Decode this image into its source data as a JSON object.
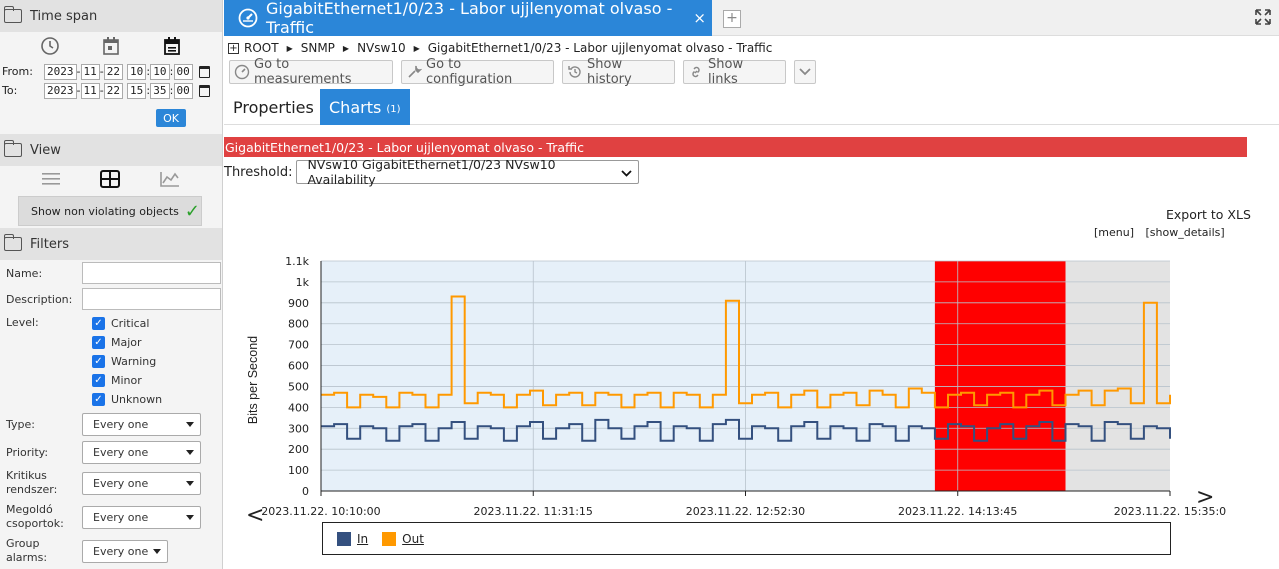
{
  "sidebar": {
    "time_span": {
      "title": "Time span",
      "from_label": "From:",
      "to_label": "To:",
      "from": {
        "year": "2023",
        "month": "11",
        "day": "22",
        "hour": "10",
        "minute": "10",
        "second": "00"
      },
      "to": {
        "year": "2023",
        "month": "11",
        "day": "22",
        "hour": "15",
        "minute": "35",
        "second": "00"
      },
      "ok_label": "OK"
    },
    "view": {
      "title": "View",
      "non_violating_label": "Show non violating objects"
    },
    "filters": {
      "title": "Filters",
      "name_label": "Name:",
      "description_label": "Description:",
      "level_label": "Level:",
      "levels": [
        "Critical",
        "Major",
        "Warning",
        "Minor",
        "Unknown"
      ],
      "type_label": "Type:",
      "priority_label": "Priority:",
      "kritikus_label_1": "Kritikus",
      "kritikus_label_2": "rendszer:",
      "megoldo_label_1": "Megoldó",
      "megoldo_label_2": "csoportok:",
      "group_label_1": "Group",
      "group_label_2": "alarms:",
      "select_value": "Every one"
    }
  },
  "tab": {
    "title": "GigabitEthernet1/0/23 - Labor ujjlenyomat olvaso - Traffic",
    "close": "×",
    "add": "+"
  },
  "breadcrumb": [
    "ROOT",
    "SNMP",
    "NVsw10",
    "GigabitEthernet1/0/23 - Labor ujjlenyomat olvaso - Traffic"
  ],
  "toolbar": {
    "measurements": "Go to measurements",
    "configuration": "Go to configuration",
    "history": "Show history",
    "links": "Show links"
  },
  "page_tabs": {
    "properties": "Properties",
    "charts": "Charts",
    "charts_count": "(1)"
  },
  "chart_banner": "GigabitEthernet1/0/23 - Labor ujjlenyomat olvaso - Traffic",
  "threshold": {
    "label": "Threshold:",
    "value": "NVsw10 GigabitEthernet1/0/23 NVsw10 Availability"
  },
  "export_label": "Export to XLS",
  "chart_links": {
    "menu": "[menu]",
    "details": "[show_details]"
  },
  "colors": {
    "accent": "#2b86d8",
    "in": "#34507f",
    "out": "#ff9900",
    "violation": "#ff0000",
    "banner": "#e04141"
  },
  "chart_data": {
    "type": "line",
    "ylabel": "Bits per Second",
    "ylim": [
      0,
      1100
    ],
    "yticks": [
      0,
      100,
      200,
      300,
      400,
      500,
      600,
      700,
      800,
      900,
      1000,
      1100
    ],
    "ytick_labels": [
      "0",
      "100",
      "200",
      "300",
      "400",
      "500",
      "600",
      "700",
      "800",
      "900",
      "1k",
      "1.1k"
    ],
    "xrange": [
      "2023.11.22. 10:10:00",
      "2023.11.22. 15:35:00"
    ],
    "xticks": [
      "2023.11.22. 10:10:00",
      "2023.11.22. 11:31:15",
      "2023.11.22. 12:52:30",
      "2023.11.22. 14:13:45",
      "2023.11.22. 15:35:0"
    ],
    "nav_prev": "<",
    "nav_next": ">",
    "violation_range": [
      "2023.11.22. 14:05",
      "2023.11.22. 14:55"
    ],
    "nodata_range": [
      "2023.11.22. 14:55",
      "2023.11.22. 15:35"
    ],
    "sample_minutes": 5,
    "series": [
      {
        "name": "In",
        "values": [
          310,
          320,
          250,
          310,
          300,
          240,
          310,
          320,
          240,
          300,
          330,
          250,
          310,
          300,
          240,
          310,
          330,
          250,
          300,
          320,
          240,
          340,
          300,
          250,
          310,
          330,
          240,
          310,
          300,
          240,
          320,
          340,
          250,
          310,
          300,
          240,
          310,
          330,
          250,
          310,
          300,
          240,
          320,
          310,
          240,
          310,
          300,
          250,
          320,
          310,
          240,
          300,
          320,
          250,
          310,
          330,
          240,
          320,
          310,
          240,
          330,
          320,
          250,
          310,
          300,
          250
        ]
      },
      {
        "name": "Out",
        "values": [
          460,
          470,
          400,
          460,
          450,
          400,
          470,
          460,
          400,
          460,
          930,
          420,
          470,
          460,
          400,
          460,
          480,
          410,
          460,
          470,
          410,
          470,
          460,
          400,
          460,
          470,
          400,
          470,
          460,
          400,
          460,
          910,
          420,
          460,
          470,
          400,
          460,
          480,
          400,
          460,
          470,
          410,
          480,
          460,
          400,
          490,
          470,
          400,
          460,
          470,
          410,
          460,
          470,
          400,
          460,
          480,
          410,
          460,
          480,
          410,
          480,
          490,
          420,
          900,
          420,
          460
        ]
      }
    ]
  }
}
